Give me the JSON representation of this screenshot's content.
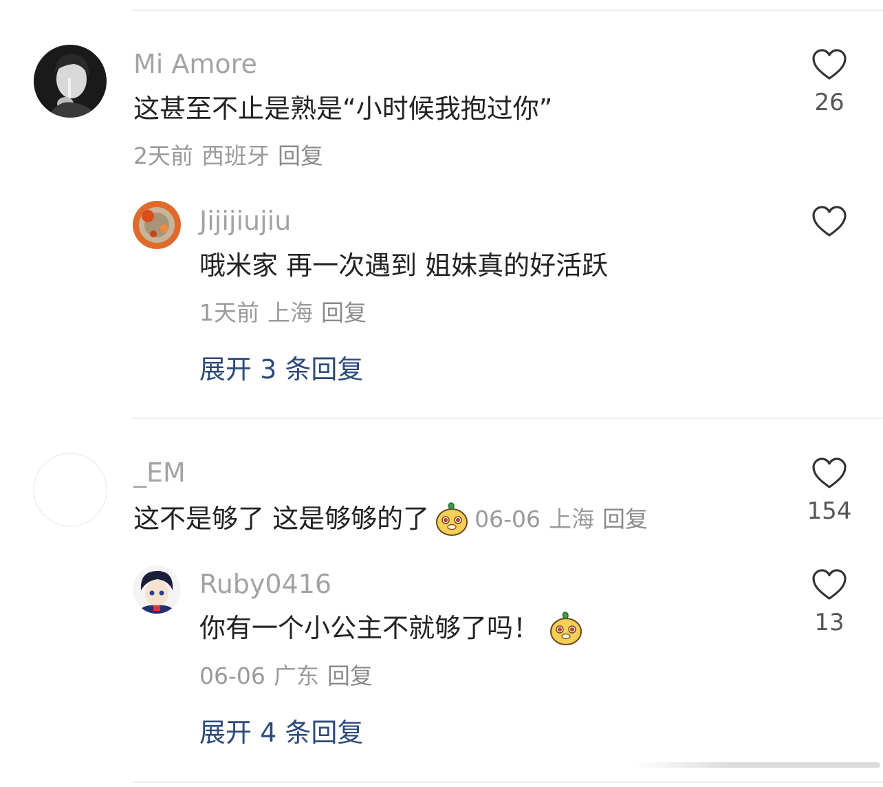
{
  "comments": [
    {
      "username": "Mi Amore",
      "text": "这甚至不止是熟是“小时候我抱过你”",
      "time": "2天前",
      "location": "西班牙",
      "reply_label": "回复",
      "likes": "26",
      "avatar_icon": "portrait-avatar-bw",
      "replies": [
        {
          "username": "Jijijiujiu",
          "text": "哦米家 再一次遇到 姐妹真的好活跃",
          "time": "1天前",
          "location": "上海",
          "reply_label": "回复",
          "avatar_icon": "orange-flower-avatar"
        }
      ],
      "expand_label": "展开 3 条回复"
    },
    {
      "username": "_EM",
      "text": "这不是够了 这是够够的了",
      "emoji": "chick-face-emoji",
      "time": "06-06",
      "location": "上海",
      "reply_label": "回复",
      "likes": "154",
      "avatar_icon": "blank-avatar",
      "replies": [
        {
          "username": "Ruby0416",
          "text": "你有一个小公主不就够了吗！",
          "emoji": "chick-face-emoji",
          "time": "06-06",
          "location": "广东",
          "reply_label": "回复",
          "likes": "13",
          "avatar_icon": "anime-character-avatar"
        }
      ],
      "expand_label": "展开 4 条回复"
    }
  ],
  "colors": {
    "username": "#a3a3a3",
    "text": "#222222",
    "meta": "#9a9a9a",
    "expand_link": "#2b4a7a",
    "divider": "#ececec",
    "heart_stroke": "#333333"
  }
}
